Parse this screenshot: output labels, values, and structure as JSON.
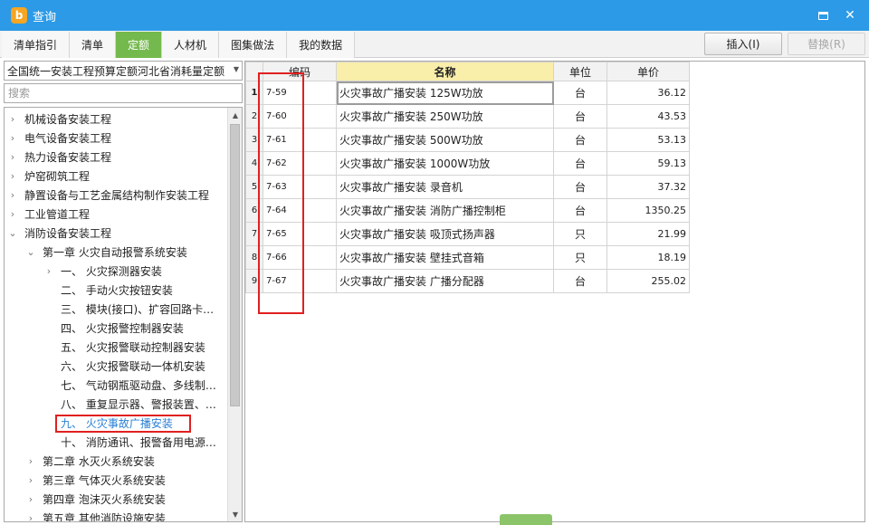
{
  "window": {
    "title": "查询",
    "icon_name": "app-logo-icon",
    "controls": [
      "maximize-icon",
      "close-icon"
    ]
  },
  "tabs": [
    {
      "label": "清单指引",
      "active": false
    },
    {
      "label": "清单",
      "active": false
    },
    {
      "label": "定额",
      "active": true
    },
    {
      "label": "人材机",
      "active": false
    },
    {
      "label": "图集做法",
      "active": false
    },
    {
      "label": "我的数据",
      "active": false
    }
  ],
  "actions": {
    "insert_label": "插入(I)",
    "replace_label": "替换(R)"
  },
  "left": {
    "dropdown_value": "全国统一安装工程预算定额河北省消耗量定额",
    "search_placeholder": "搜索",
    "tree": [
      {
        "label": "机械设备安装工程",
        "level": 0,
        "state": "collapsed"
      },
      {
        "label": "电气设备安装工程",
        "level": 0,
        "state": "collapsed"
      },
      {
        "label": "热力设备安装工程",
        "level": 0,
        "state": "collapsed"
      },
      {
        "label": "炉窑砌筑工程",
        "level": 0,
        "state": "collapsed"
      },
      {
        "label": "静置设备与工艺金属结构制作安装工程",
        "level": 0,
        "state": "collapsed"
      },
      {
        "label": "工业管道工程",
        "level": 0,
        "state": "collapsed"
      },
      {
        "label": "消防设备安装工程",
        "level": 0,
        "state": "expanded"
      },
      {
        "label": "第一章  火灾自动报警系统安装",
        "level": 1,
        "state": "expanded"
      },
      {
        "label": "一、  火灾探测器安装",
        "level": 2,
        "state": "collapsed"
      },
      {
        "label": "二、  手动火灾按钮安装",
        "level": 2,
        "state": "leaf"
      },
      {
        "label": "三、  模块(接口)、扩容回路卡…",
        "level": 2,
        "state": "leaf"
      },
      {
        "label": "四、  火灾报警控制器安装",
        "level": 2,
        "state": "leaf"
      },
      {
        "label": "五、  火灾报警联动控制器安装",
        "level": 2,
        "state": "leaf"
      },
      {
        "label": "六、  火灾报警联动一体机安装",
        "level": 2,
        "state": "leaf"
      },
      {
        "label": "七、  气动钢瓶驱动盘、多线制…",
        "level": 2,
        "state": "leaf"
      },
      {
        "label": "八、  重复显示器、警报装置、…",
        "level": 2,
        "state": "leaf"
      },
      {
        "label": "九、  火灾事故广播安装",
        "level": 2,
        "state": "leaf",
        "selected": true
      },
      {
        "label": "十、  消防通讯、报警备用电源…",
        "level": 2,
        "state": "leaf"
      },
      {
        "label": "第二章  水灭火系统安装",
        "level": 1,
        "state": "collapsed"
      },
      {
        "label": "第三章  气体灭火系统安装",
        "level": 1,
        "state": "collapsed"
      },
      {
        "label": "第四章  泡沫灭火系统安装",
        "level": 1,
        "state": "collapsed"
      },
      {
        "label": "第五章  其他消防设施安装",
        "level": 1,
        "state": "collapsed"
      }
    ]
  },
  "table": {
    "columns": {
      "code": "编码",
      "name": "名称",
      "unit": "单位",
      "price": "单价"
    },
    "rows": [
      {
        "num": "1",
        "code": "7-59",
        "name": "火灾事故广播安装 125W功放",
        "unit": "台",
        "price": "36.12"
      },
      {
        "num": "2",
        "code": "7-60",
        "name": "火灾事故广播安装 250W功放",
        "unit": "台",
        "price": "43.53"
      },
      {
        "num": "3",
        "code": "7-61",
        "name": "火灾事故广播安装 500W功放",
        "unit": "台",
        "price": "53.13"
      },
      {
        "num": "4",
        "code": "7-62",
        "name": "火灾事故广播安装 1000W功放",
        "unit": "台",
        "price": "59.13"
      },
      {
        "num": "5",
        "code": "7-63",
        "name": "火灾事故广播安装 录音机",
        "unit": "台",
        "price": "37.32"
      },
      {
        "num": "6",
        "code": "7-64",
        "name": "火灾事故广播安装 消防广播控制柜",
        "unit": "台",
        "price": "1350.25"
      },
      {
        "num": "7",
        "code": "7-65",
        "name": "火灾事故广播安装 吸顶式扬声器",
        "unit": "只",
        "price": "21.99"
      },
      {
        "num": "8",
        "code": "7-66",
        "name": "火灾事故广播安装 壁挂式音箱",
        "unit": "只",
        "price": "18.19"
      },
      {
        "num": "9",
        "code": "7-67",
        "name": "火灾事故广播安装 广播分配器",
        "unit": "台",
        "price": "255.02"
      }
    ]
  },
  "colors": {
    "titlebar": "#2c9ae6",
    "active_tab": "#74b94d",
    "name_header": "#f9eeaa",
    "annotation": "#e02020",
    "selected_tree_text": "#2a7fd4"
  }
}
